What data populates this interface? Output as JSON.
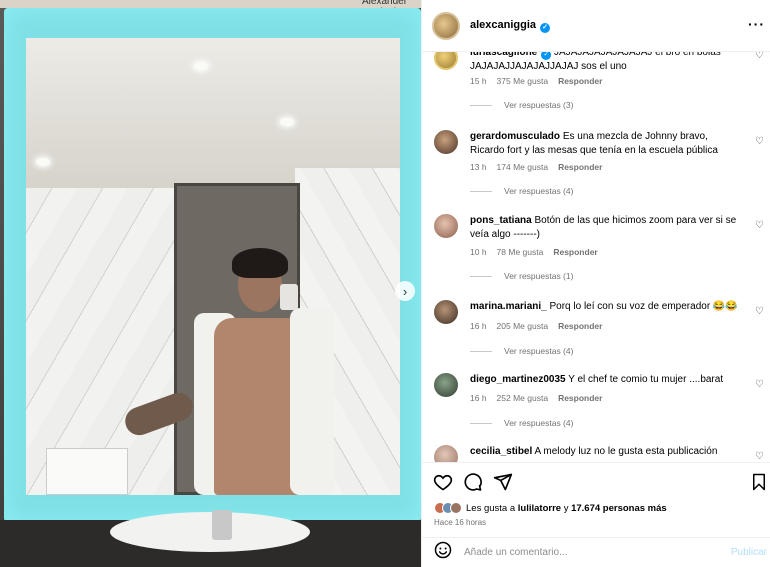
{
  "photo": {
    "top_caption": "Alexander Caniggia"
  },
  "header": {
    "username": "alexcaniggia"
  },
  "comments": [
    {
      "user": "luriascaglione",
      "text": "JAJAJAJAJAJAJAJAJ el bro en bolas JAJAJAJJAJAJAJJAJAJ sos el uno",
      "time": "15 h",
      "likes": "375 Me gusta",
      "reply": "Responder",
      "view": "Ver respuestas (3)"
    },
    {
      "user": "gerardomusculado",
      "text": "Es una mezcla de Johnny bravo, Ricardo fort y las mesas que tenía en la escuela pública",
      "time": "13 h",
      "likes": "174 Me gusta",
      "reply": "Responder",
      "view": "Ver respuestas (4)"
    },
    {
      "user": "pons_tatiana",
      "text": "Botón de las que hicimos zoom para ver si se veía algo -------)",
      "time": "10 h",
      "likes": "78 Me gusta",
      "reply": "Responder",
      "view": "Ver respuestas (1)"
    },
    {
      "user": "marina.mariani_",
      "text": "Porq lo leí con su voz de emperador 😂😂",
      "time": "16 h",
      "likes": "205 Me gusta",
      "reply": "Responder",
      "view": "Ver respuestas (4)"
    },
    {
      "user": "diego_martinez0035",
      "text": "Y el chef te comio tu mujer ....barat",
      "time": "16 h",
      "likes": "252 Me gusta",
      "reply": "Responder",
      "view": "Ver respuestas (4)"
    },
    {
      "user": "cecilia_stibel",
      "text": "A melody luz no le gusta esta publicación",
      "time": "",
      "likes": "",
      "reply": "",
      "view": ""
    }
  ],
  "likes_line": {
    "prefix": "Les gusta a ",
    "user": "lulilatorre",
    "middle": " y ",
    "count": "17.674 personas más"
  },
  "time_ago": "Hace 16 horas",
  "add_comment": {
    "placeholder": "Añade un comentario...",
    "publish": "Publicar"
  },
  "icons": [
    "heart-icon",
    "comment-icon",
    "share-icon",
    "bookmark-icon",
    "emoji-icon",
    "more-icon",
    "verified-icon",
    "chevron-right-icon"
  ]
}
